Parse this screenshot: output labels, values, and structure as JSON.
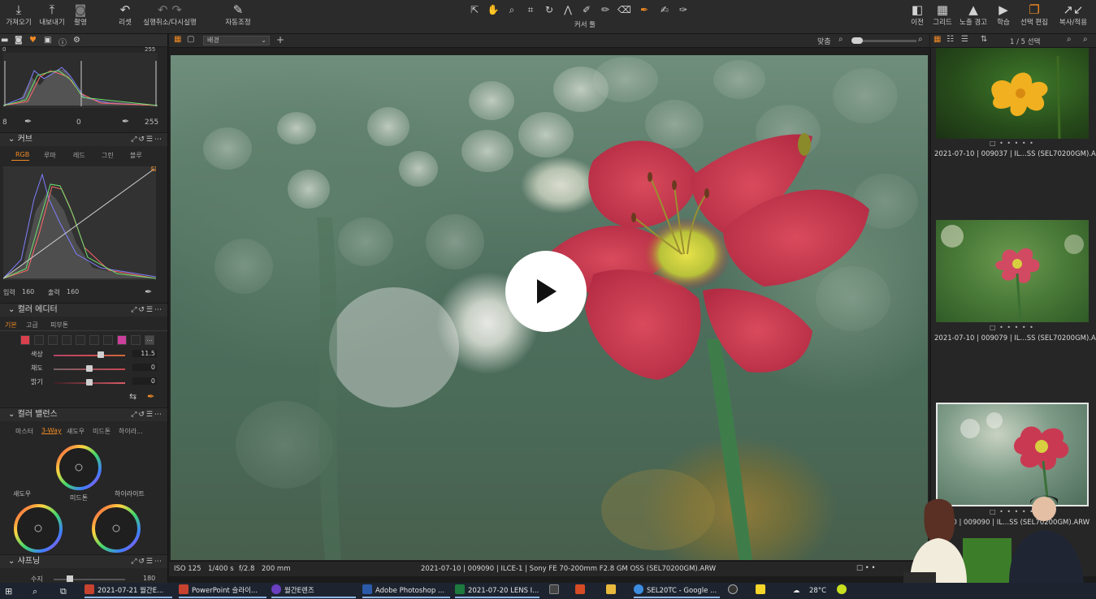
{
  "toolbar": {
    "left_buttons": [
      {
        "label": "가져오기",
        "icon": "import-icon"
      },
      {
        "label": "내보내기",
        "icon": "export-icon"
      },
      {
        "label": "촬영",
        "icon": "camera-icon"
      },
      {
        "label": "리셋",
        "icon": "reset-icon"
      },
      {
        "label": "실행취소/다시실행",
        "icon": "undo-redo-icon"
      },
      {
        "label": "자동조정",
        "icon": "auto-adjust-icon"
      }
    ],
    "cursor_tools_label": "커서 툴",
    "right_buttons": [
      {
        "label": "이전",
        "icon": "before-after-icon"
      },
      {
        "label": "그리드",
        "icon": "grid-icon"
      },
      {
        "label": "노출 경고",
        "icon": "exposure-warning-icon"
      },
      {
        "label": "학습",
        "icon": "learn-icon"
      },
      {
        "label": "선택 편집",
        "icon": "edit-selection-icon"
      },
      {
        "label": "복사/적용",
        "icon": "copy-apply-icon"
      }
    ],
    "accent": "#f08a24"
  },
  "levels": {
    "input_low": "8",
    "mid": "0",
    "input_high": "255",
    "top_right": "255",
    "top_left": "0"
  },
  "curve": {
    "title": "커브",
    "tabs": [
      "RGB",
      "루마",
      "레드",
      "그린",
      "블루"
    ],
    "active_tab": "RGB",
    "input_label": "입력",
    "input_value": "160",
    "output_label": "출력",
    "output_value": "160"
  },
  "color_editor": {
    "title": "컬러 에디터",
    "tabs": [
      "기본",
      "고급",
      "피부톤"
    ],
    "active_tab": "기본",
    "sliders": [
      {
        "label": "색상",
        "value": "11.5",
        "pos": 0.66
      },
      {
        "label": "채도",
        "value": "0",
        "pos": 0.5
      },
      {
        "label": "밝기",
        "value": "0",
        "pos": 0.5
      }
    ],
    "swatch_colors": [
      "#d9404d",
      "#cc3f9c"
    ]
  },
  "color_balance": {
    "title": "컬러 밸런스",
    "tabs": [
      "마스터",
      "3-Way",
      "섀도우",
      "미드톤",
      "하이라..."
    ],
    "active_tab": "3-Way",
    "wheel_labels": {
      "shadow": "섀도우",
      "midtone": "미드톤",
      "highlight": "하이라이트"
    }
  },
  "sharpening": {
    "title": "샤프닝",
    "row_label": "수지",
    "row_value": "180"
  },
  "viewer": {
    "variant_select": "배경",
    "fit_label": "맞춤",
    "status_left": [
      "ISO 125",
      "1/400 s",
      "f/2.8",
      "200 mm"
    ],
    "status_center": "2021-07-10 | 009090 | ILCE-1 | Sony FE 70-200mm F2.8 GM OSS (SEL70200GM).ARW"
  },
  "browser": {
    "count": "1 / 5 선택",
    "items": [
      {
        "caption": "2021-07-10 | 009037 | IL...SS  (SEL70200GM).ARW"
      },
      {
        "caption": "2021-07-10 | 009079 | IL...SS  (SEL70200GM).ARW"
      },
      {
        "caption": "-07-10 | 009090 | IL...SS  (SEL70200GM).ARW"
      }
    ]
  },
  "taskbar": {
    "items": [
      {
        "label": "2021-07-21 월간E...",
        "color": "#c8432f"
      },
      {
        "label": "PowerPoint 슬라이...",
        "color": "#c8432f"
      },
      {
        "label": "월간E렌즈",
        "color": "#6a3fc0"
      },
      {
        "label": "Adobe Photoshop ...",
        "color": "#2b5aa8"
      },
      {
        "label": "2021-07-20 LENS I...",
        "color": "#1e7a3e"
      },
      {
        "label": "SEL20TC - Google ...",
        "color": "#3c8de0"
      }
    ],
    "weather": "28°C"
  }
}
